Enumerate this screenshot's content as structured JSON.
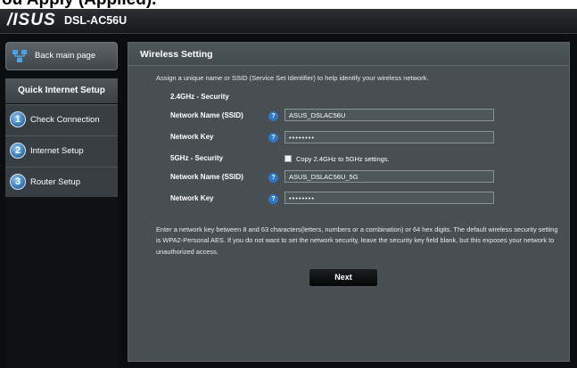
{
  "caption": {
    "text": "ou Apply (Applied)."
  },
  "header": {
    "brand": "/ISUS",
    "model": "DSL-AC56U"
  },
  "nav": {
    "back_label": "Back main page",
    "title": "Quick Internet Setup",
    "steps": [
      {
        "num": "1",
        "label": "Check Connection"
      },
      {
        "num": "2",
        "label": "Internet Setup"
      },
      {
        "num": "3",
        "label": "Router Setup"
      }
    ]
  },
  "main": {
    "title": "Wireless Setting",
    "intro": "Assign a unique name or SSID (Service Set Identifier) to help identify your wireless network.",
    "band24": {
      "section": "2.4GHz - Security",
      "ssid_label": "Network Name (SSID)",
      "ssid_value": "ASUS_DSLAC56U",
      "key_label": "Network Key",
      "key_value": "••••••••"
    },
    "band5": {
      "section": "5GHz - Security",
      "copy_label": "Copy 2.4GHz to 5GHz settings.",
      "ssid_label": "Network Name (SSID)",
      "ssid_value": "ASUS_DSLAC56U_5G",
      "key_label": "Network Key",
      "key_value": "••••••••"
    },
    "help_glyph": "?",
    "note": "Enter a network key between 8 and 63 characters(letters, numbers or a combination) or 64 hex digits. The default wireless security setting is WPA2-Personal AES. If you do not want to set the network security, leave the security key field blank, but this exposes your network to unauthorized access.",
    "next_label": "Next"
  },
  "colors": {
    "accent": "#2c78c4",
    "panel": "#474f53",
    "background": "#0c0d0e"
  }
}
